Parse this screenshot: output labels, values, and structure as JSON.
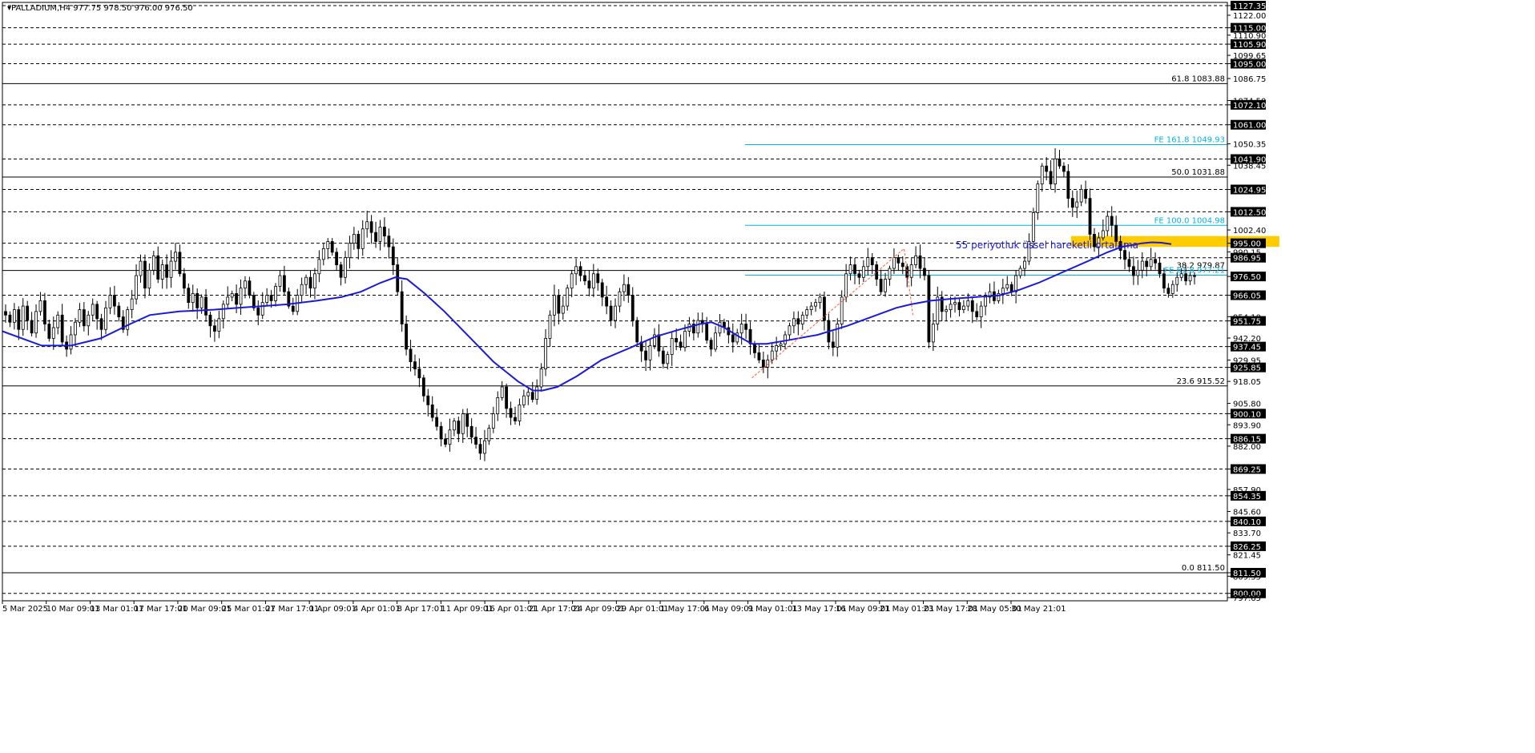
{
  "header": {
    "symbol": "PALLADIUM,H4",
    "ohlc": "977.75 978.50 976.00 976.50"
  },
  "annotation": {
    "ema_label": "55 periyotluk üssel hareketli ortalama"
  },
  "colors": {
    "candle": "#000000",
    "ema": "#1a1adb",
    "fib_expansion": "#00b4e6",
    "highlight_box": "#ffcc00",
    "trend_dashed": "#ff5c33",
    "price_box_bg": "#000000",
    "price_box_text": "#ffffff"
  },
  "chart_data": {
    "type": "candlestick",
    "instrument": "PALLADIUM",
    "timeframe": "H4",
    "ylim": [
      797.65,
      1127.35
    ],
    "x_labels": [
      "5 Mar 2025",
      "10 Mar 09:01",
      "13 Mar 01:01",
      "17 Mar 17:01",
      "20 Mar 09:01",
      "25 Mar 01:01",
      "27 Mar 17:01",
      "1 Apr 09:01",
      "4 Apr 01:01",
      "8 Apr 17:01",
      "11 Apr 09:01",
      "16 Apr 01:01",
      "21 Apr 17:01",
      "24 Apr 09:01",
      "29 Apr 01:01",
      "1 May 17:01",
      "6 May 09:01",
      "9 May 01:01",
      "13 May 17:01",
      "16 May 09:01",
      "21 May 01:01",
      "23 May 17:01",
      "28 May 05:01",
      "30 May 21:01"
    ],
    "y_axis_labels": [
      {
        "value": 1127.35,
        "text": "1127.35",
        "boxed": true
      },
      {
        "value": 1122.0,
        "text": "1122.00",
        "boxed": false
      },
      {
        "value": 1115.0,
        "text": "1115.00",
        "boxed": true
      },
      {
        "value": 1110.9,
        "text": "1110.90",
        "boxed": false
      },
      {
        "value": 1105.9,
        "text": "1105.90",
        "boxed": true
      },
      {
        "value": 1099.65,
        "text": "1099.65",
        "boxed": false
      },
      {
        "value": 1095.0,
        "text": "1095.00",
        "boxed": true
      },
      {
        "value": 1086.75,
        "text": "1086.75",
        "boxed": false
      },
      {
        "value": 1074.5,
        "text": "1074.50",
        "boxed": false
      },
      {
        "value": 1072.1,
        "text": "1072.10",
        "boxed": true
      },
      {
        "value": 1061.0,
        "text": "1061.00",
        "boxed": true
      },
      {
        "value": 1050.35,
        "text": "1050.35",
        "boxed": false
      },
      {
        "value": 1041.9,
        "text": "1041.90",
        "boxed": true
      },
      {
        "value": 1038.45,
        "text": "1038.45",
        "boxed": false
      },
      {
        "value": 1024.95,
        "text": "1024.95",
        "boxed": true
      },
      {
        "value": 1012.5,
        "text": "1012.50",
        "boxed": true
      },
      {
        "value": 1002.4,
        "text": "1002.40",
        "boxed": false
      },
      {
        "value": 995.0,
        "text": "995.00",
        "boxed": true
      },
      {
        "value": 990.15,
        "text": "990.15",
        "boxed": false
      },
      {
        "value": 986.95,
        "text": "986.95",
        "boxed": true
      },
      {
        "value": 976.5,
        "text": "976.50",
        "boxed": true
      },
      {
        "value": 966.05,
        "text": "966.05",
        "boxed": true
      },
      {
        "value": 954.1,
        "text": "954.10",
        "boxed": false
      },
      {
        "value": 951.75,
        "text": "951.75",
        "boxed": true
      },
      {
        "value": 942.2,
        "text": "942.20",
        "boxed": false
      },
      {
        "value": 937.45,
        "text": "937.45",
        "boxed": true
      },
      {
        "value": 929.95,
        "text": "929.95",
        "boxed": false
      },
      {
        "value": 925.85,
        "text": "925.85",
        "boxed": true
      },
      {
        "value": 918.05,
        "text": "918.05",
        "boxed": false
      },
      {
        "value": 905.8,
        "text": "905.80",
        "boxed": false
      },
      {
        "value": 900.1,
        "text": "900.10",
        "boxed": true
      },
      {
        "value": 893.9,
        "text": "893.90",
        "boxed": false
      },
      {
        "value": 886.15,
        "text": "886.15",
        "boxed": true
      },
      {
        "value": 882.0,
        "text": "882.00",
        "boxed": false
      },
      {
        "value": 869.25,
        "text": "869.25",
        "boxed": true
      },
      {
        "value": 857.9,
        "text": "857.90",
        "boxed": false
      },
      {
        "value": 854.35,
        "text": "854.35",
        "boxed": true
      },
      {
        "value": 845.6,
        "text": "845.60",
        "boxed": false
      },
      {
        "value": 840.1,
        "text": "840.10",
        "boxed": true
      },
      {
        "value": 833.7,
        "text": "833.70",
        "boxed": false
      },
      {
        "value": 826.25,
        "text": "826.25",
        "boxed": true
      },
      {
        "value": 821.45,
        "text": "821.45",
        "boxed": false
      },
      {
        "value": 809.55,
        "text": "809.55",
        "boxed": false
      },
      {
        "value": 811.5,
        "text": "811.50",
        "boxed": true
      },
      {
        "value": 800.0,
        "text": "800.00",
        "boxed": true
      },
      {
        "value": 797.65,
        "text": "797.65",
        "boxed": false
      }
    ],
    "horizontal_dashed_levels": [
      1127.35,
      1115.0,
      1105.9,
      1095.0,
      1072.1,
      1061.0,
      1041.9,
      1024.95,
      1012.5,
      995.0,
      986.95,
      966.05,
      951.75,
      937.45,
      925.85,
      900.1,
      886.15,
      869.25,
      854.35,
      840.1,
      826.25,
      800.0
    ],
    "fib_retracement": [
      {
        "label": "61.8 1083.88",
        "value": 1083.88
      },
      {
        "label": "50.0 1031.88",
        "value": 1031.88
      },
      {
        "label": "38.2 979.87",
        "value": 979.87
      },
      {
        "label": "23.6 915.52",
        "value": 915.52
      },
      {
        "label": "0.0 811.50",
        "value": 811.5
      }
    ],
    "fib_expansion": [
      {
        "label": "FE 161.8 1049.93",
        "value": 1049.93
      },
      {
        "label": "FE 100.0 1004.98",
        "value": 1004.98
      },
      {
        "label": "FE 61.8 977.21",
        "value": 977.21
      }
    ],
    "closes": [
      955,
      951,
      958,
      947,
      960,
      952,
      945,
      957,
      963,
      950,
      942,
      948,
      955,
      940,
      936,
      944,
      951,
      958,
      949,
      955,
      961,
      953,
      947,
      959,
      966,
      960,
      954,
      947,
      958,
      964,
      977,
      985,
      970,
      980,
      988,
      975,
      983,
      976,
      985,
      990,
      978,
      970,
      962,
      967,
      959,
      965,
      955,
      949,
      946,
      953,
      961,
      965,
      967,
      961,
      970,
      974,
      966,
      959,
      955,
      962,
      966,
      963,
      971,
      977,
      968,
      960,
      957,
      966,
      972,
      976,
      970,
      978,
      986,
      992,
      996,
      990,
      983,
      976,
      987,
      995,
      1000,
      992,
      1003,
      1007,
      1001,
      996,
      1004,
      999,
      993,
      983,
      968,
      950,
      936,
      929,
      925,
      920,
      910,
      905,
      898,
      893,
      886,
      883,
      891,
      896,
      889,
      900,
      893,
      887,
      883,
      878,
      885,
      892,
      900,
      909,
      915,
      903,
      898,
      896,
      905,
      910,
      912,
      908,
      915,
      925,
      942,
      955,
      966,
      956,
      960,
      970,
      978,
      982,
      977,
      974,
      970,
      978,
      973,
      965,
      960,
      952,
      960,
      968,
      972,
      966,
      952,
      940,
      935,
      930,
      938,
      944,
      935,
      928,
      933,
      942,
      940,
      937,
      946,
      950,
      945,
      952,
      950,
      941,
      936,
      945,
      951,
      948,
      944,
      940,
      945,
      950,
      947,
      939,
      934,
      930,
      926,
      930,
      935,
      938,
      939,
      944,
      949,
      953,
      950,
      955,
      958,
      960,
      962,
      965,
      952,
      940,
      937,
      950,
      965,
      978,
      983,
      978,
      976,
      982,
      987,
      983,
      975,
      968,
      975,
      981,
      987,
      984,
      982,
      976,
      983,
      988,
      981,
      977,
      940,
      950,
      965,
      957,
      958,
      961,
      962,
      958,
      960,
      963,
      957,
      954,
      960,
      965,
      968,
      963,
      967,
      970,
      972,
      968,
      977,
      981,
      985,
      996,
      1012,
      1028,
      1038,
      1035,
      1028,
      1042,
      1038,
      1035,
      1020,
      1015,
      1018,
      1025,
      1020,
      1000,
      993,
      998,
      1002,
      1010,
      1005,
      996,
      991,
      986,
      982,
      977,
      980,
      985,
      982,
      986,
      984,
      978,
      970,
      967,
      972,
      976,
      978,
      974,
      977,
      976.5
    ],
    "ema55": [
      {
        "x": 0,
        "y": 946
      },
      {
        "x": 40,
        "y": 938
      },
      {
        "x": 70,
        "y": 938
      },
      {
        "x": 100,
        "y": 942
      },
      {
        "x": 130,
        "y": 950
      },
      {
        "x": 150,
        "y": 955
      },
      {
        "x": 180,
        "y": 957
      },
      {
        "x": 215,
        "y": 958
      },
      {
        "x": 240,
        "y": 959
      },
      {
        "x": 265,
        "y": 960
      },
      {
        "x": 290,
        "y": 961
      },
      {
        "x": 320,
        "y": 963
      },
      {
        "x": 345,
        "y": 965
      },
      {
        "x": 365,
        "y": 968
      },
      {
        "x": 385,
        "y": 973
      },
      {
        "x": 400,
        "y": 976
      },
      {
        "x": 412,
        "y": 975
      },
      {
        "x": 430,
        "y": 967
      },
      {
        "x": 450,
        "y": 957
      },
      {
        "x": 475,
        "y": 943
      },
      {
        "x": 500,
        "y": 929
      },
      {
        "x": 525,
        "y": 918
      },
      {
        "x": 540,
        "y": 913
      },
      {
        "x": 550,
        "y": 913
      },
      {
        "x": 565,
        "y": 915
      },
      {
        "x": 585,
        "y": 921
      },
      {
        "x": 610,
        "y": 930
      },
      {
        "x": 640,
        "y": 937
      },
      {
        "x": 665,
        "y": 943
      },
      {
        "x": 690,
        "y": 947
      },
      {
        "x": 710,
        "y": 950
      },
      {
        "x": 722,
        "y": 951
      },
      {
        "x": 735,
        "y": 948
      },
      {
        "x": 750,
        "y": 943
      },
      {
        "x": 763,
        "y": 939
      },
      {
        "x": 778,
        "y": 939
      },
      {
        "x": 800,
        "y": 941
      },
      {
        "x": 830,
        "y": 944
      },
      {
        "x": 860,
        "y": 949
      },
      {
        "x": 890,
        "y": 955
      },
      {
        "x": 910,
        "y": 959
      },
      {
        "x": 925,
        "y": 961
      },
      {
        "x": 945,
        "y": 963
      },
      {
        "x": 965,
        "y": 964
      },
      {
        "x": 990,
        "y": 965
      },
      {
        "x": 1015,
        "y": 966
      },
      {
        "x": 1035,
        "y": 969
      },
      {
        "x": 1055,
        "y": 973
      },
      {
        "x": 1080,
        "y": 979
      },
      {
        "x": 1105,
        "y": 985
      },
      {
        "x": 1125,
        "y": 990
      },
      {
        "x": 1140,
        "y": 993
      },
      {
        "x": 1160,
        "y": 995
      },
      {
        "x": 1170,
        "y": 995.5
      },
      {
        "x": 1180,
        "y": 995.3
      },
      {
        "x": 1190,
        "y": 994.5
      }
    ],
    "fe_swing_dashed": [
      {
        "x": 763,
        "y": 920
      },
      {
        "x": 918,
        "y": 992
      },
      {
        "x": 927,
        "y": 955
      }
    ],
    "highlight_zone": {
      "y_from": 993,
      "y_to": 999,
      "x_from": 1088,
      "x_to": 1300
    }
  }
}
